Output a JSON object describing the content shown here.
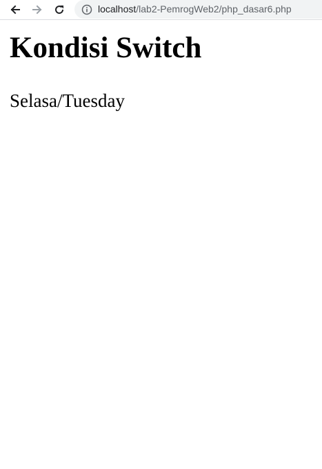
{
  "browser": {
    "url_host": "localhost",
    "url_path": "/lab2-PemrogWeb2/php_dasar6.php",
    "icons": {
      "back": "arrow-left-icon",
      "forward": "arrow-right-icon",
      "reload": "reload-icon",
      "info": "info-icon"
    },
    "colors": {
      "omnibox_bg": "#f1f3f4",
      "host_text": "#202124",
      "path_text": "#5f6368",
      "forward_disabled": "#9aa0a6"
    }
  },
  "page": {
    "heading": "Kondisi Switch",
    "output": "Selasa/Tuesday"
  }
}
